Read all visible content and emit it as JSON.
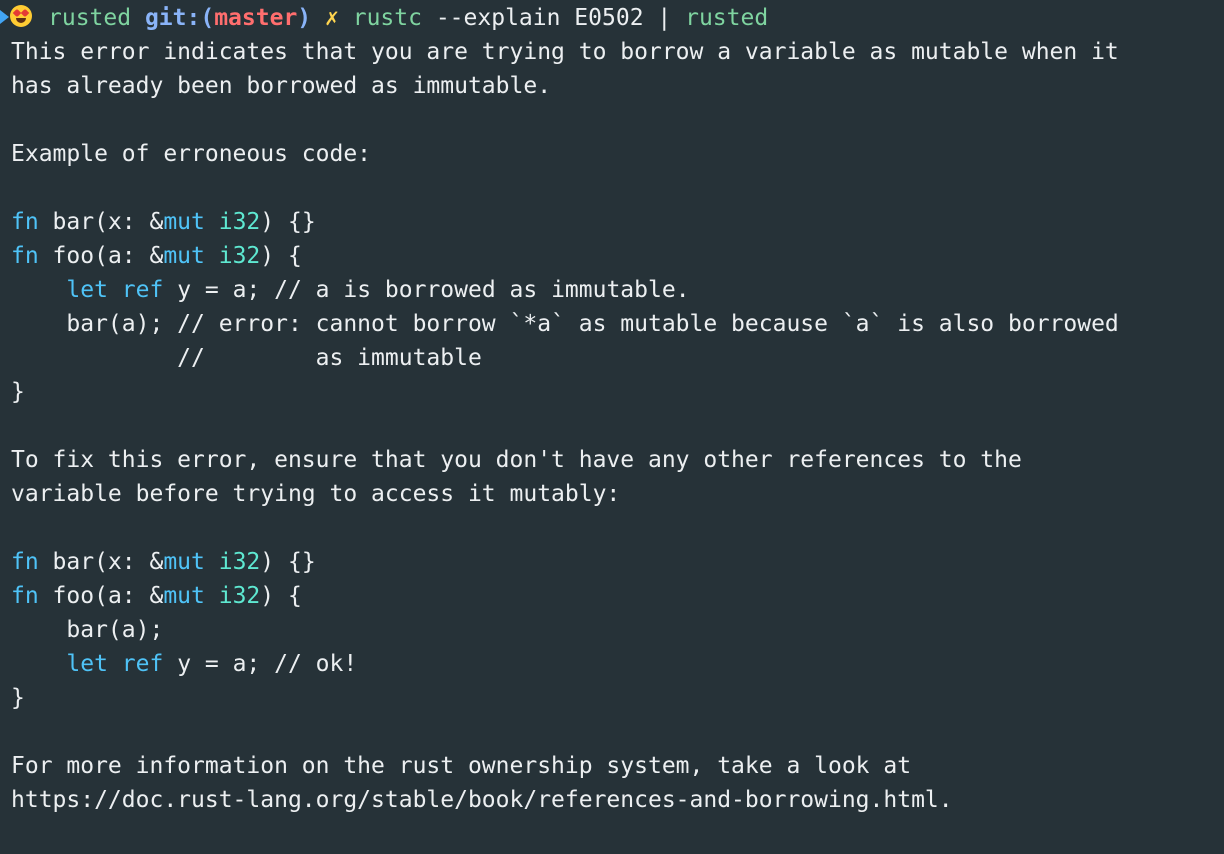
{
  "prompt": {
    "directory": "rusted",
    "git_label": "git:(",
    "branch": "master",
    "git_close": ")",
    "dirty_mark": "✗",
    "command_name": "rustc",
    "command_args": " --explain E0502 | ",
    "pipe_target": "rusted"
  },
  "explanation": {
    "intro_1": "This error indicates that you are trying to borrow a variable as mutable when it",
    "intro_2": "has already been borrowed as immutable.",
    "example_heading": "Example of erroneous code:",
    "fix_1": "To fix this error, ensure that you don't have any other references to the",
    "fix_2": "variable before trying to access it mutably:",
    "more_1": "For more information on the rust ownership system, take a look at",
    "more_2": "https://doc.rust-lang.org/stable/book/references-and-borrowing.html."
  },
  "code": {
    "kw_fn": "fn",
    "kw_mut": "mut",
    "kw_let": "let",
    "kw_ref": "ref",
    "type_i32": "i32",
    "bar_sig_a": " bar(x: &",
    "sig_end_bar": ") {}",
    "foo_sig_a": " foo(a: &",
    "sig_end_foo": ") {",
    "indent": "    ",
    "space": " ",
    "let_rest_err": " y = a; // a is borrowed as immutable.",
    "bar_call_err": "    bar(a); // error: cannot borrow `*a` as mutable because `a` is also borrowed",
    "err_cont": "            //        as immutable",
    "close_brace": "}",
    "bar_call_ok": "    bar(a);",
    "let_rest_ok": " y = a; // ok!"
  }
}
